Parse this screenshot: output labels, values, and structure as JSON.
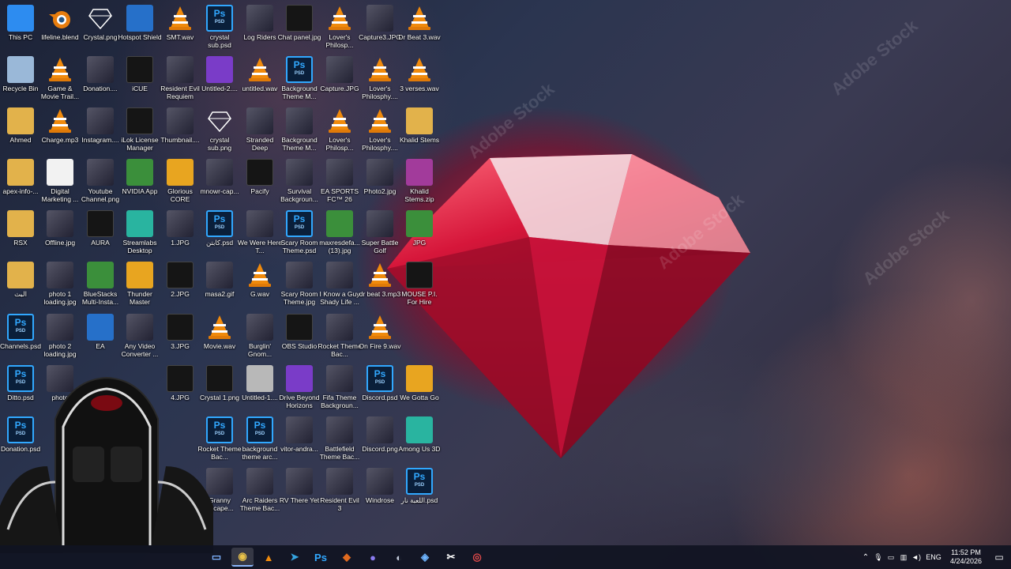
{
  "desktop": {
    "icons": [
      {
        "label": "This PC",
        "icon": "computer-icon",
        "type": "pc"
      },
      {
        "label": "lifeline.blend",
        "icon": "blender-icon",
        "type": "blend"
      },
      {
        "label": "Crystal.png",
        "icon": "image-icon",
        "type": "crystal"
      },
      {
        "label": "Hotspot Shield",
        "icon": "hotspot-shield-icon",
        "type": "blue"
      },
      {
        "label": "SMT.wav",
        "icon": "vlc-icon",
        "type": "vlc"
      },
      {
        "label": "crystal sub.psd",
        "icon": "photoshop-file-icon",
        "type": "ps"
      },
      {
        "label": "Log Riders",
        "icon": "game-icon",
        "type": "img"
      },
      {
        "label": "Chat panel.jpg",
        "icon": "image-icon",
        "type": "dark"
      },
      {
        "label": "Lover's Philosp...",
        "icon": "vlc-icon",
        "type": "vlc"
      },
      {
        "label": "Capture3.JPG",
        "icon": "image-icon",
        "type": "img"
      },
      {
        "label": "Dr Beat 3.wav",
        "icon": "vlc-icon",
        "type": "vlc"
      },
      {
        "label": "Recycle Bin",
        "icon": "recycle-bin-icon",
        "type": "bin"
      },
      {
        "label": "Game & Movie Trail...",
        "icon": "vlc-icon",
        "type": "vlc"
      },
      {
        "label": "Donation....",
        "icon": "image-icon",
        "type": "img"
      },
      {
        "label": "iCUE",
        "icon": "icue-icon",
        "type": "dark"
      },
      {
        "label": "Resident Evil Requiem",
        "icon": "game-icon",
        "type": "img"
      },
      {
        "label": "Untitled-2....",
        "icon": "gem-icon",
        "type": "purple"
      },
      {
        "label": "untitled.wav",
        "icon": "vlc-icon",
        "type": "vlc"
      },
      {
        "label": "Background Theme M...",
        "icon": "photoshop-file-icon",
        "type": "ps"
      },
      {
        "label": "Capture.JPG",
        "icon": "image-icon",
        "type": "img"
      },
      {
        "label": "Lover's Philosphy....",
        "icon": "vlc-icon",
        "type": "vlc"
      },
      {
        "label": "3 verses.wav",
        "icon": "vlc-icon",
        "type": "vlc"
      },
      {
        "label": "Ahmed",
        "icon": "folder-icon",
        "type": "folder"
      },
      {
        "label": "Charge.mp3",
        "icon": "vlc-icon",
        "type": "vlc"
      },
      {
        "label": "Instagram....",
        "icon": "image-icon",
        "type": "img"
      },
      {
        "label": "iLok License Manager",
        "icon": "ilok-icon",
        "type": "dark"
      },
      {
        "label": "Thumbnail....",
        "icon": "image-icon",
        "type": "img"
      },
      {
        "label": "crystal sub.png",
        "icon": "gem-icon",
        "type": "crystal"
      },
      {
        "label": "Stranded Deep",
        "icon": "game-icon",
        "type": "img"
      },
      {
        "label": "Background Theme M...",
        "icon": "image-icon",
        "type": "img"
      },
      {
        "label": "Lover's Philosp...",
        "icon": "vlc-icon",
        "type": "vlc"
      },
      {
        "label": "Lover's Philosphy....",
        "icon": "vlc-icon",
        "type": "vlc"
      },
      {
        "label": "Khalid Stems",
        "icon": "folder-icon",
        "type": "folder"
      },
      {
        "label": "apex-info-...",
        "icon": "apex-icon",
        "type": "folder"
      },
      {
        "label": "Digital Marketing ...",
        "icon": "document-icon",
        "type": "doc"
      },
      {
        "label": "Youtube Channel.png",
        "icon": "image-icon",
        "type": "img"
      },
      {
        "label": "NVIDIA App",
        "icon": "nvidia-icon",
        "type": "green"
      },
      {
        "label": "Glorious CORE",
        "icon": "glorious-icon",
        "type": "orange"
      },
      {
        "label": "mnowr-cap...",
        "icon": "image-icon",
        "type": "img"
      },
      {
        "label": "Pacify",
        "icon": "game-icon",
        "type": "dark"
      },
      {
        "label": "Survival Backgroun...",
        "icon": "image-icon",
        "type": "img"
      },
      {
        "label": "EA SPORTS FC™ 26",
        "icon": "game-icon",
        "type": "img"
      },
      {
        "label": "Photo2.jpg",
        "icon": "image-icon",
        "type": "img"
      },
      {
        "label": "Khalid Stems.zip",
        "icon": "zip-icon",
        "type": "zip"
      },
      {
        "label": "RSX",
        "icon": "folder-icon",
        "type": "folder"
      },
      {
        "label": "Offline.jpg",
        "icon": "image-icon",
        "type": "img"
      },
      {
        "label": "AURA",
        "icon": "aura-icon",
        "type": "dark"
      },
      {
        "label": "Streamlabs Desktop",
        "icon": "streamlabs-icon",
        "type": "teal"
      },
      {
        "label": "1.JPG",
        "icon": "image-icon",
        "type": "img"
      },
      {
        "label": "كابتن.psd",
        "icon": "photoshop-file-icon",
        "type": "ps"
      },
      {
        "label": "We Were Here T...",
        "icon": "game-icon",
        "type": "img"
      },
      {
        "label": "Scary Room Theme.psd",
        "icon": "photoshop-file-icon",
        "type": "ps"
      },
      {
        "label": "maxresdefa... (13).jpg",
        "icon": "image-icon",
        "type": "green"
      },
      {
        "label": "Super Battle Golf",
        "icon": "game-icon",
        "type": "img"
      },
      {
        "label": "JPG",
        "icon": "image-icon",
        "type": "green"
      },
      {
        "label": "البث",
        "icon": "folder-icon",
        "type": "folder"
      },
      {
        "label": "photo 1 loading.jpg",
        "icon": "image-icon",
        "type": "img"
      },
      {
        "label": "BlueStacks Multi-Insta...",
        "icon": "bluestacks-icon",
        "type": "green"
      },
      {
        "label": "Thunder Master",
        "icon": "thunder-icon",
        "type": "orange"
      },
      {
        "label": "2.JPG",
        "icon": "image-icon",
        "type": "dark"
      },
      {
        "label": "masa2.gif",
        "icon": "image-icon",
        "type": "img"
      },
      {
        "label": "G.wav",
        "icon": "vlc-icon",
        "type": "vlc"
      },
      {
        "label": "Scary Room Theme.jpg",
        "icon": "image-icon",
        "type": "img"
      },
      {
        "label": "I Know a Guy Shady Life ...",
        "icon": "game-icon",
        "type": "img"
      },
      {
        "label": "dr beat 3.mp3",
        "icon": "vlc-icon",
        "type": "vlc"
      },
      {
        "label": "MOUSE P.I. For Hire",
        "icon": "game-icon",
        "type": "dark"
      },
      {
        "label": "Channels.psd",
        "icon": "photoshop-file-icon",
        "type": "ps"
      },
      {
        "label": "photo 2 loading.jpg",
        "icon": "image-icon",
        "type": "img"
      },
      {
        "label": "EA",
        "icon": "ea-icon",
        "type": "blue"
      },
      {
        "label": "Any Video Converter ...",
        "icon": "video-converter-icon",
        "type": "img"
      },
      {
        "label": "3.JPG",
        "icon": "image-icon",
        "type": "dark"
      },
      {
        "label": "Movie.wav",
        "icon": "vlc-icon",
        "type": "vlc"
      },
      {
        "label": "Burglin' Gnom...",
        "icon": "game-icon",
        "type": "img"
      },
      {
        "label": "OBS Studio",
        "icon": "obs-icon",
        "type": "dark"
      },
      {
        "label": "Rocket Theme Bac...",
        "icon": "image-icon",
        "type": "img"
      },
      {
        "label": "On Fire 9.wav",
        "icon": "vlc-icon",
        "type": "vlc"
      },
      {
        "label": "Ditto.psd",
        "icon": "photoshop-file-icon",
        "type": "ps"
      },
      {
        "label": "photo",
        "icon": "image-icon",
        "type": "img"
      },
      {
        "label": "4.JPG",
        "icon": "image-icon",
        "type": "dark"
      },
      {
        "label": "Crystal 1.png",
        "icon": "gem-icon",
        "type": "dark"
      },
      {
        "label": "Untitled-1....",
        "icon": "image-icon",
        "type": "gray"
      },
      {
        "label": "Drive Beyond Horizons",
        "icon": "game-icon",
        "type": "purple"
      },
      {
        "label": "Fifa Theme Backgroun...",
        "icon": "image-icon",
        "type": "img"
      },
      {
        "label": "Discord.psd",
        "icon": "photoshop-file-icon",
        "type": "ps"
      },
      {
        "label": "We Gotta Go",
        "icon": "game-icon",
        "type": "orange"
      },
      {
        "label": "Donation.psd",
        "icon": "photoshop-file-icon",
        "type": "ps"
      },
      {
        "label": "Rocket Theme Bac...",
        "icon": "photoshop-file-icon",
        "type": "ps"
      },
      {
        "label": "background theme arc...",
        "icon": "photoshop-file-icon",
        "type": "ps"
      },
      {
        "label": "vitor-andra...",
        "icon": "image-icon",
        "type": "img"
      },
      {
        "label": "Battlefield Theme Bac...",
        "icon": "image-icon",
        "type": "img"
      },
      {
        "label": "Discord.png",
        "icon": "image-icon",
        "type": "img"
      },
      {
        "label": "Among Us 3D",
        "icon": "game-icon",
        "type": "teal"
      },
      {
        "label": "Granny Escape...",
        "icon": "game-icon",
        "type": "img"
      },
      {
        "label": "Arc Raiders Theme Bac...",
        "icon": "image-icon",
        "type": "img"
      },
      {
        "label": "RV There Yet",
        "icon": "game-icon",
        "type": "img"
      },
      {
        "label": "Resident Evil 3",
        "icon": "game-icon",
        "type": "img"
      },
      {
        "label": "Windrose",
        "icon": "game-icon",
        "type": "img"
      },
      {
        "label": "اللعبة نار.psd",
        "icon": "photoshop-file-icon",
        "type": "ps"
      }
    ]
  },
  "ps_text": "Ps",
  "psd_text": "PSD",
  "taskbar": {
    "apps": [
      {
        "name": "file-explorer-icon",
        "glyph": "▭"
      },
      {
        "name": "chrome-icon",
        "glyph": "◉"
      },
      {
        "name": "vlc-icon",
        "glyph": "▲"
      },
      {
        "name": "telegram-icon",
        "glyph": "➤"
      },
      {
        "name": "photoshop-icon",
        "glyph": "Ps"
      },
      {
        "name": "shield-icon",
        "glyph": "◆"
      },
      {
        "name": "discord-icon",
        "glyph": "●"
      },
      {
        "name": "steam-icon",
        "glyph": "◐"
      },
      {
        "name": "vpn-icon",
        "glyph": "◈"
      },
      {
        "name": "capcut-icon",
        "glyph": "✂"
      },
      {
        "name": "recorder-icon",
        "glyph": "◎"
      }
    ],
    "tray": {
      "language": "ENG",
      "time": "11:52 PM",
      "date": "4/24/2026"
    }
  },
  "wallpaper": {
    "watermark": "Adobe Stock"
  }
}
